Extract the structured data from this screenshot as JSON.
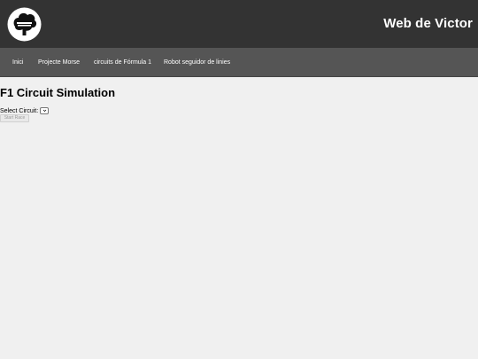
{
  "header": {
    "site_title": "Web de Victor"
  },
  "nav": {
    "items": [
      {
        "label": "Inici"
      },
      {
        "label": "Projecte Morse"
      },
      {
        "label": "circuits de Fórmula 1"
      },
      {
        "label": "Robot seguidor de linies"
      }
    ]
  },
  "main": {
    "title": "F1 Circuit Simulation",
    "select_label": "Select Circuit:",
    "select_value": "",
    "start_button": "Start Race"
  },
  "colors": {
    "header_bg": "#333333",
    "nav_bg": "#555555",
    "page_bg": "#f0f0f0"
  },
  "icons": {
    "logo": "tree-logo-icon",
    "select": "chevron-down-icon"
  }
}
